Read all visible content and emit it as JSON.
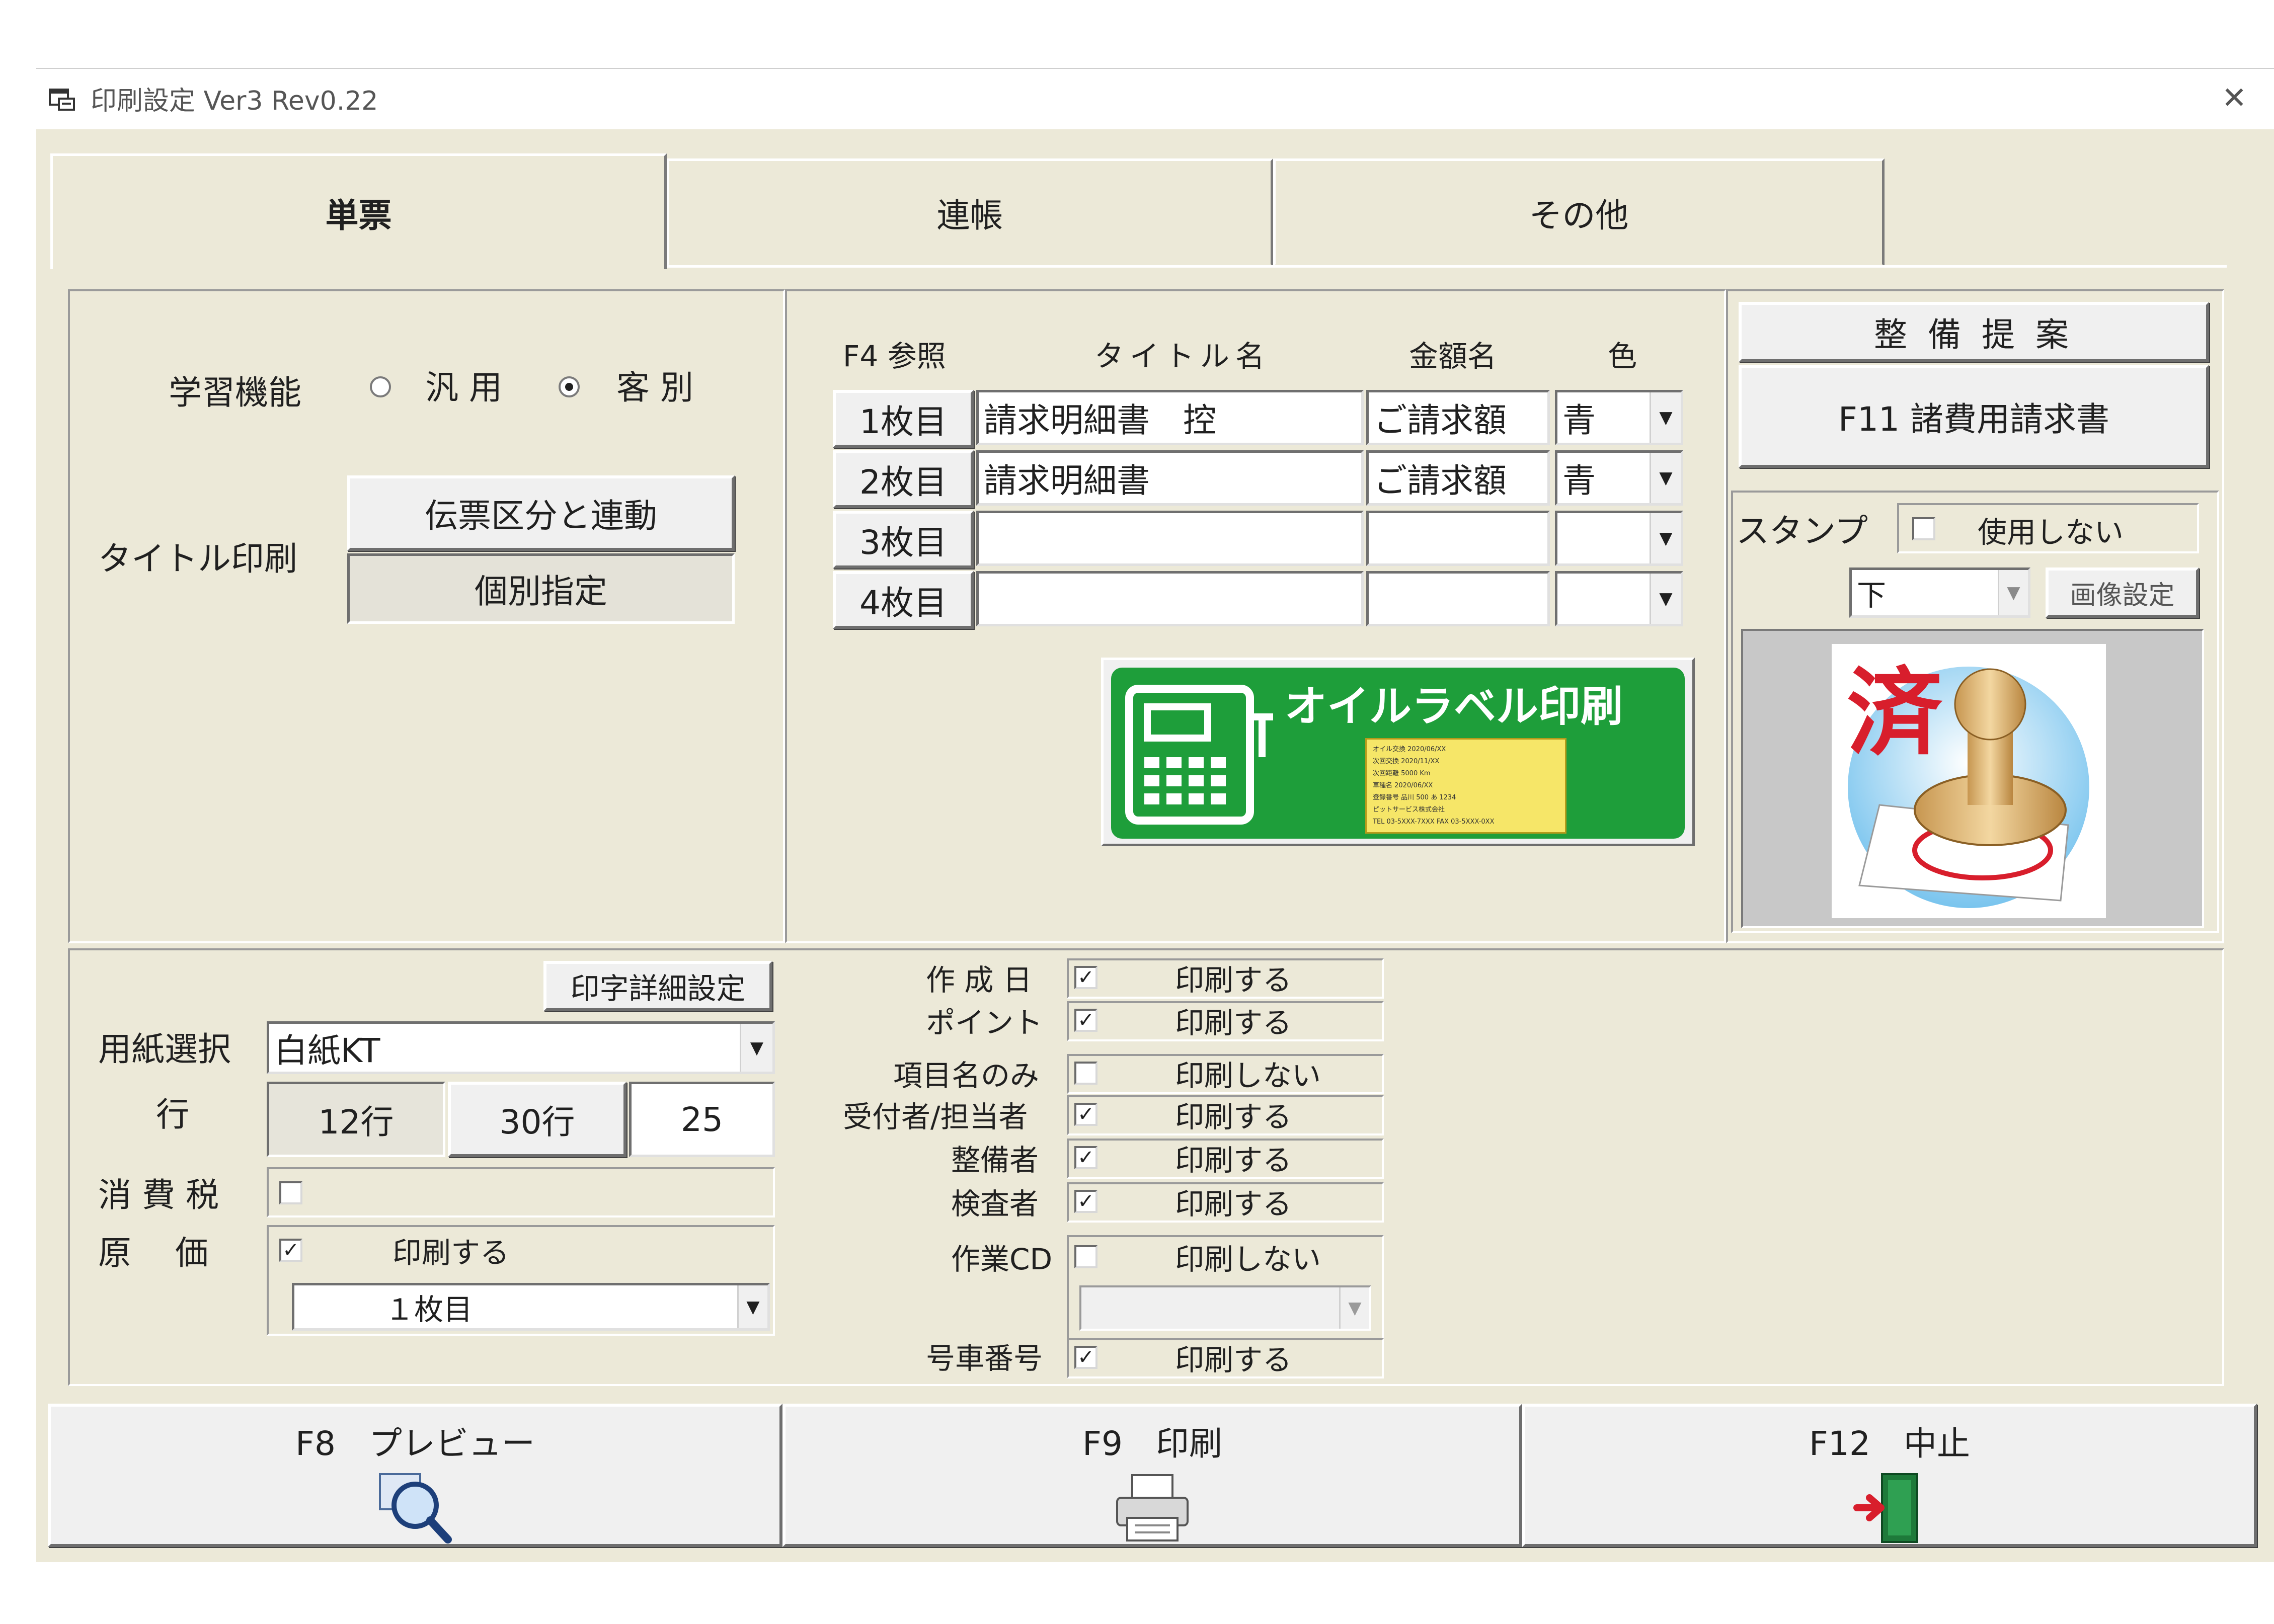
{
  "window": {
    "title": "印刷設定 Ver3 Rev0.22"
  },
  "tabs": [
    {
      "label": "単票",
      "active": true
    },
    {
      "label": "連帳",
      "active": false
    },
    {
      "label": "その他",
      "active": false
    }
  ],
  "learning": {
    "label": "学習機能",
    "option_general": "汎 用",
    "option_customer": "客 別",
    "selected": "客別"
  },
  "title_print": {
    "label": "タイトル印刷",
    "btn_link": "伝票区分と連動",
    "btn_individual": "個別指定"
  },
  "sheet_table": {
    "headers": {
      "ref": "F4 参照",
      "title": "タイトル名",
      "amount": "金額名",
      "color": "色"
    },
    "rows": [
      {
        "sheet": "1枚目",
        "title": "請求明細書　控",
        "amount": "ご請求額",
        "color": "青"
      },
      {
        "sheet": "2枚目",
        "title": "請求明細書",
        "amount": "ご請求額",
        "color": "青"
      },
      {
        "sheet": "3枚目",
        "title": "",
        "amount": "",
        "color": ""
      },
      {
        "sheet": "4枚目",
        "title": "",
        "amount": "",
        "color": ""
      }
    ]
  },
  "oil_label": {
    "text": "オイルラベル印刷",
    "card_rows": [
      "オイル交換 2020/06/XX",
      "次回交換 2020/11/XX",
      "次回距離 5000 Km",
      "車種名 2020/06/XX",
      "登録番号 品川 500 あ 1234",
      "ピットサービス株式会社",
      "TEL 03-5XXX-7XXX FAX 03-5XXX-0XX"
    ],
    "accent_color": "#1e9e3a"
  },
  "maintenance": {
    "proposal_btn": "整 備 提 案",
    "f11_btn": "F11 諸費用請求書"
  },
  "stamp": {
    "label": "スタンプ",
    "use_label": "使用しない",
    "use_checked": false,
    "position": "下",
    "image_btn": "画像設定",
    "stamp_char": "済"
  },
  "print_detail_btn": "印字詳細設定",
  "paper": {
    "label": "用紙選択",
    "value": "白紙KT"
  },
  "rows_setting": {
    "label": "行",
    "opt12": "12行",
    "opt30": "30行",
    "value": "25"
  },
  "tax": {
    "label": "消 費 税",
    "checked": false
  },
  "cost": {
    "label": "原　 価",
    "checked": true,
    "print_label": "印刷する",
    "sheet": "１枚目"
  },
  "print_items": [
    {
      "label": "作 成 日",
      "checked": true,
      "state": "印刷する"
    },
    {
      "label": "ポイント",
      "checked": true,
      "state": "印刷する"
    },
    {
      "label": "項目名のみ",
      "checked": false,
      "state": "印刷しない"
    },
    {
      "label": "受付者/担当者",
      "checked": true,
      "state": "印刷する"
    },
    {
      "label": "整備者",
      "checked": true,
      "state": "印刷する"
    },
    {
      "label": "検査者",
      "checked": true,
      "state": "印刷する"
    },
    {
      "label": "作業CD",
      "checked": false,
      "state": "印刷しない"
    },
    {
      "label": "号車番号",
      "checked": true,
      "state": "印刷する"
    }
  ],
  "footer": {
    "preview": "F8　プレビュー",
    "print": "F9　印刷",
    "cancel": "F12　中止"
  },
  "glyphs": {
    "check": "✓",
    "arrow_down": "▼",
    "close": "✕"
  }
}
